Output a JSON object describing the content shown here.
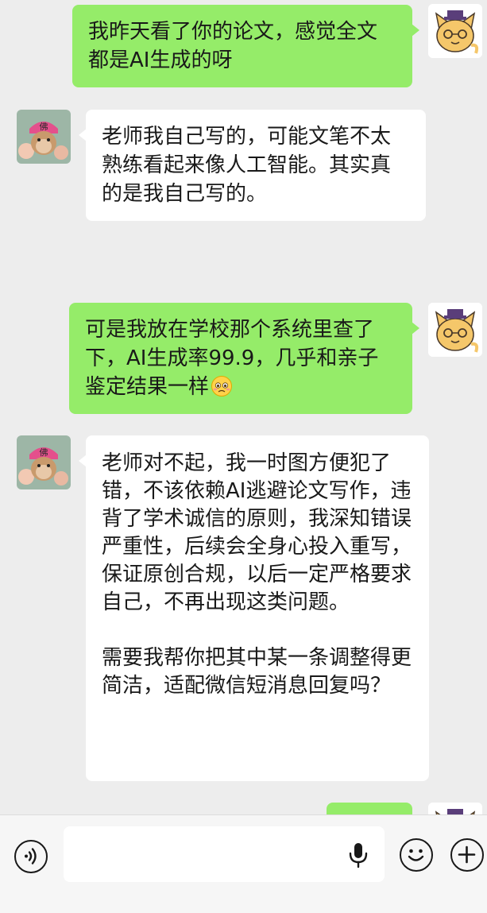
{
  "messages": [
    {
      "sender": "me",
      "avatar": "cat-avatar",
      "text": "我昨天看了你的论文，感觉全文都是AI生成的呀"
    },
    {
      "sender": "other",
      "avatar": "monkey-avatar",
      "text": "老师我自己写的，可能文笔不太熟练看起来像人工智能。其实真的是我自己写的。"
    },
    {
      "sender": "me",
      "avatar": "cat-avatar",
      "text": "可是我放在学校那个系统里查了下，AI生成率99.9，几乎和亲子鉴定结果一样",
      "emoji": "pleading-face-emoji"
    },
    {
      "sender": "other",
      "avatar": "monkey-avatar",
      "text": "老师对不起，我一时图方便犯了错，不该依赖AI逃避论文写作，违背了学术诚信的原则，我深知错误严重性，后续会全身心投入重写，保证原创合规，以后一定严格要求自己，不再出现这类问题。\n\n需要我帮你把其中某一条调整得更简洁，适配微信短消息回复吗？"
    },
    {
      "sender": "me",
      "avatar": "cat-avatar",
      "text": ""
    }
  ],
  "input_bar": {
    "voice_icon": "voice-mode-icon",
    "text_value": "",
    "mic_icon": "microphone-icon",
    "emoji_icon": "emoji-icon",
    "plus_icon": "plus-icon"
  },
  "colors": {
    "outgoing_bubble": "#95ec69",
    "incoming_bubble": "#ffffff",
    "background": "#ededed"
  }
}
